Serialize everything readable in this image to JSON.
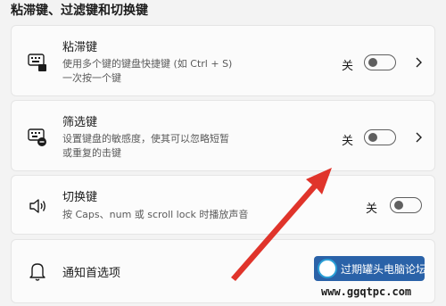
{
  "section": {
    "title": "粘滞键、过滤键和切换键"
  },
  "settings": [
    {
      "title": "粘滞键",
      "desc1": "使用多个键的键盘快捷键 (如 Ctrl + S)",
      "desc2": "一次按一个键",
      "state": "关",
      "icon": "sticky-keys-icon"
    },
    {
      "title": "筛选键",
      "desc1": "设置键盘的敏感度，使其可以忽略短暂",
      "desc2": "或重复的击键",
      "state": "关",
      "icon": "filter-keys-icon"
    },
    {
      "title": "切换键",
      "desc1": "按 Caps、num 或 scroll lock 时播放声音",
      "state": "关",
      "icon": "speaker-icon"
    },
    {
      "title": "通知首选项",
      "icon": "bell-icon"
    }
  ],
  "watermark": {
    "text": "过期罐头电脑论坛",
    "url": "www.ggqtpc.com"
  },
  "colors": {
    "arrow": "#e0342b",
    "toggle_off": "#5f5f5f",
    "card_bg": "#fbfbfb",
    "page_bg": "#f3f3f3"
  }
}
